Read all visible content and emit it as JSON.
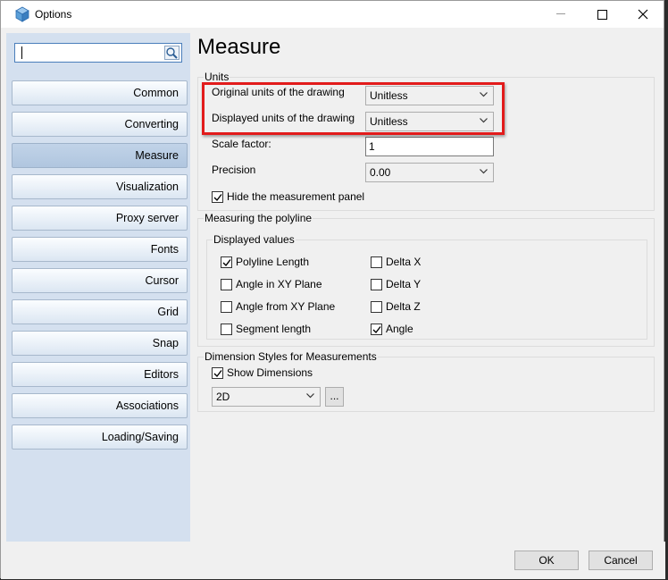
{
  "window": {
    "title": "Options"
  },
  "search": {
    "value": ""
  },
  "sidebar": {
    "items": [
      {
        "label": "Common"
      },
      {
        "label": "Converting"
      },
      {
        "label": "Measure"
      },
      {
        "label": "Visualization"
      },
      {
        "label": "Proxy server"
      },
      {
        "label": "Fonts"
      },
      {
        "label": "Cursor"
      },
      {
        "label": "Grid"
      },
      {
        "label": "Snap"
      },
      {
        "label": "Editors"
      },
      {
        "label": "Associations"
      },
      {
        "label": "Loading/Saving"
      }
    ],
    "active": "Measure"
  },
  "page": {
    "title": "Measure"
  },
  "units": {
    "group_label": "Units",
    "original_label": "Original units of the drawing",
    "original_value": "Unitless",
    "displayed_label": "Displayed units of the drawing",
    "displayed_value": "Unitless",
    "scale_label": "Scale factor:",
    "scale_value": "1",
    "precision_label": "Precision",
    "precision_value": "0.00",
    "hide_panel_label": "Hide the measurement panel",
    "hide_panel_checked": true
  },
  "polyline": {
    "group_label": "Measuring the polyline",
    "displayed_values_label": "Displayed values",
    "options": {
      "polyline_length": {
        "label": "Polyline Length",
        "checked": true
      },
      "angle_xy": {
        "label": "Angle in XY Plane",
        "checked": false
      },
      "angle_from_xy": {
        "label": "Angle from XY Plane",
        "checked": false
      },
      "segment_length": {
        "label": "Segment length",
        "checked": false
      },
      "delta_x": {
        "label": "Delta X",
        "checked": false
      },
      "delta_y": {
        "label": "Delta Y",
        "checked": false
      },
      "delta_z": {
        "label": "Delta Z",
        "checked": false
      },
      "angle": {
        "label": "Angle",
        "checked": true
      }
    }
  },
  "dimension": {
    "group_label": "Dimension Styles for Measurements",
    "show_label": "Show Dimensions",
    "show_checked": true,
    "style_value": "2D",
    "browse_label": "..."
  },
  "buttons": {
    "ok": "OK",
    "cancel": "Cancel"
  },
  "colors": {
    "highlight": "#e21b1b",
    "sidebar_bg": "#d4e0ef",
    "accent": "#4a7ebb"
  }
}
